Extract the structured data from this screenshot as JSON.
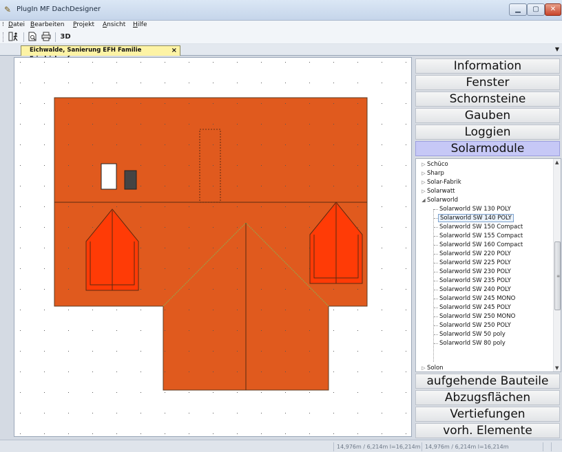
{
  "window": {
    "title": "PlugIn MF DachDesigner"
  },
  "menu": {
    "items": [
      {
        "underline": "D",
        "rest": "atei"
      },
      {
        "underline": "B",
        "rest": "earbeiten"
      },
      {
        "underline": "P",
        "rest": "rojekt"
      },
      {
        "underline": "A",
        "rest": "nsicht"
      },
      {
        "underline": "H",
        "rest": "ilfe"
      }
    ]
  },
  "toolbar": {
    "btn_3d": "3D"
  },
  "tab": {
    "title": "Eichwalde, Sanierung EFH Familie Friedrich.mfs",
    "close": "×"
  },
  "panel": {
    "sections_top": [
      "Information",
      "Fenster",
      "Schornsteine",
      "Gauben",
      "Loggien",
      "Solarmodule"
    ],
    "sections_bottom": [
      "aufgehende Bauteile",
      "Abzugsflächen",
      "Vertiefungen",
      "vorh. Elemente"
    ],
    "active": "Solarmodule"
  },
  "tree": {
    "parents": [
      "Schüco",
      "Sharp",
      "Solar-Fabrik",
      "Solarwatt",
      "Solarworld"
    ],
    "children": [
      "Solarworld SW 130 POLY",
      "Solarworld SW 140 POLY",
      "Solarworld SW 150 Compact",
      "Solarworld SW 155 Compact",
      "Solarworld SW 160 Compact",
      "Solarworld SW 220 POLY",
      "Solarworld SW 225 POLY",
      "Solarworld SW 230 POLY",
      "Solarworld SW 235 POLY",
      "Solarworld SW 240 POLY",
      "Solarworld SW 245 MONO",
      "Solarworld SW 245 POLY",
      "Solarworld SW 250 MONO",
      "Solarworld SW 250 POLY",
      "Solarworld SW 50 poly",
      "Solarworld SW 80 poly"
    ],
    "selected": "Solarworld SW 140 POLY",
    "next_parent": "Solon"
  },
  "status": {
    "cell1": "14,976m / 6,214m l=16,214m",
    "cell2": "14,976m / 6,214m l=16,214m"
  },
  "colors": {
    "roof": "#e05a1e",
    "solar_area": "#ff3b06",
    "active_section": "#c6c8f6"
  }
}
